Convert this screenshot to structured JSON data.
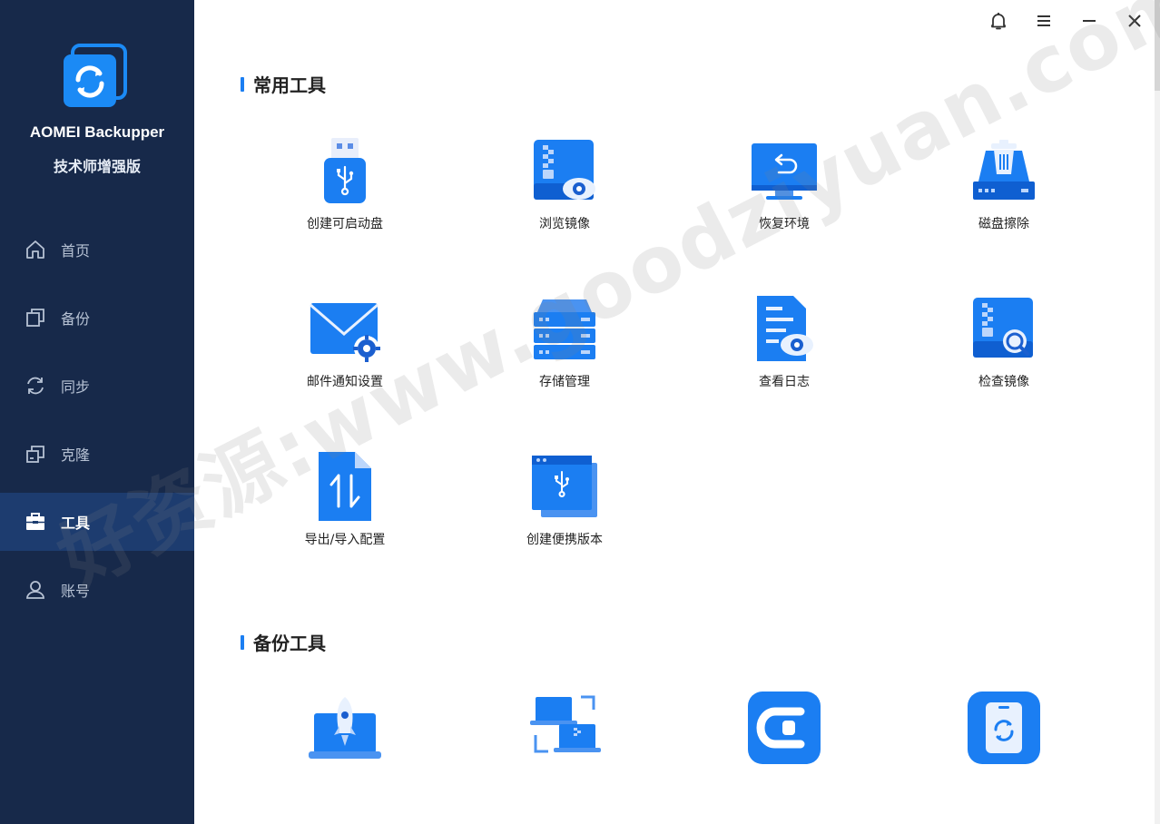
{
  "app": {
    "name": "AOMEI Backupper",
    "edition": "技术师增强版"
  },
  "nav": {
    "items": [
      {
        "label": "首页",
        "icon": "home-icon"
      },
      {
        "label": "备份",
        "icon": "backup-icon"
      },
      {
        "label": "同步",
        "icon": "sync-icon"
      },
      {
        "label": "克隆",
        "icon": "clone-icon"
      },
      {
        "label": "工具",
        "icon": "toolbox-icon",
        "active": true
      },
      {
        "label": "账号",
        "icon": "user-icon"
      }
    ]
  },
  "sections": {
    "common": {
      "title": "常用工具",
      "tools": [
        {
          "label": "创建可启动盘",
          "icon": "usb-drive-icon"
        },
        {
          "label": "浏览镜像",
          "icon": "explore-image-icon"
        },
        {
          "label": "恢复环境",
          "icon": "recovery-environment-icon"
        },
        {
          "label": "磁盘擦除",
          "icon": "disk-wipe-icon"
        },
        {
          "label": "邮件通知设置",
          "icon": "email-settings-icon"
        },
        {
          "label": "存储管理",
          "icon": "storage-management-icon"
        },
        {
          "label": "查看日志",
          "icon": "view-logs-icon"
        },
        {
          "label": "检查镜像",
          "icon": "check-image-icon"
        },
        {
          "label": "导出/导入配置",
          "icon": "export-import-icon"
        },
        {
          "label": "创建便携版本",
          "icon": "portable-version-icon"
        }
      ]
    },
    "backup": {
      "title": "备份工具",
      "tools": [
        {
          "label": "",
          "icon": "pxe-boot-icon"
        },
        {
          "label": "",
          "icon": "image-deploy-icon"
        },
        {
          "label": "",
          "icon": "centralized-backupper-icon"
        },
        {
          "label": "",
          "icon": "iphone-backup-icon"
        }
      ]
    }
  },
  "watermark": "好资源:www.goodziyuan.com",
  "colors": {
    "sidebar_bg": "#17294a",
    "sidebar_active": "#1d3c6f",
    "accent": "#1b7ef2"
  }
}
